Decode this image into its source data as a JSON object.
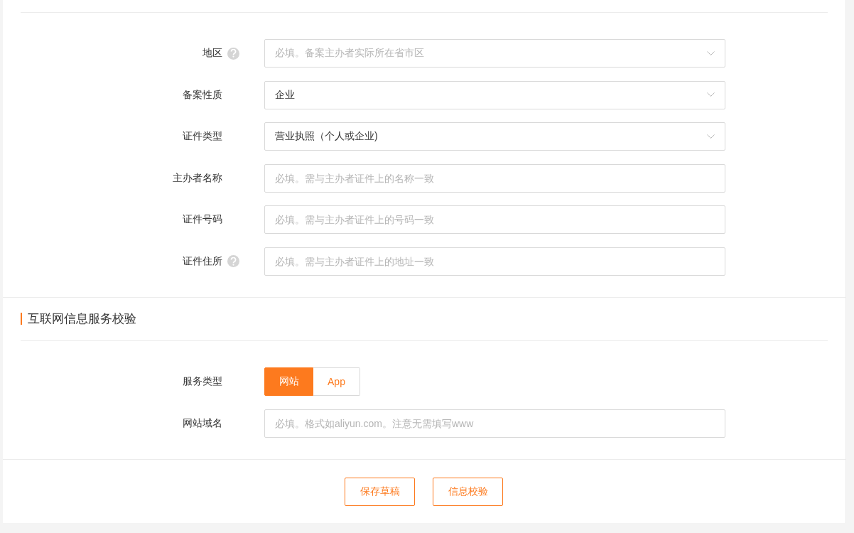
{
  "basic_fields": [
    {
      "kind": "select",
      "label": "地区",
      "help": true,
      "placeholder": "必填。备案主办者实际所在省市区"
    },
    {
      "kind": "select",
      "label": "备案性质",
      "help": false,
      "value": "企业"
    },
    {
      "kind": "select",
      "label": "证件类型",
      "help": false,
      "value": "营业执照（个人或企业)"
    },
    {
      "kind": "input",
      "label": "主办者名称",
      "help": false,
      "placeholder": "必填。需与主办者证件上的名称一致"
    },
    {
      "kind": "input",
      "label": "证件号码",
      "help": false,
      "placeholder": "必填。需与主办者证件上的号码一致"
    },
    {
      "kind": "input",
      "label": "证件住所",
      "help": true,
      "placeholder": "必填。需与主办者证件上的地址一致"
    }
  ],
  "service_section": {
    "title": "互联网信息服务校验",
    "fields": [
      {
        "kind": "segmented",
        "label": "服务类型",
        "help": false,
        "options": [
          {
            "label": "网站",
            "selected": true
          },
          {
            "label": "App",
            "selected": false
          }
        ]
      },
      {
        "kind": "input",
        "label": "网站域名",
        "help": false,
        "placeholder": "必填。格式如aliyun.com。注意无需填写www"
      }
    ]
  },
  "buttons": [
    "保存草稿",
    "信息校验"
  ]
}
